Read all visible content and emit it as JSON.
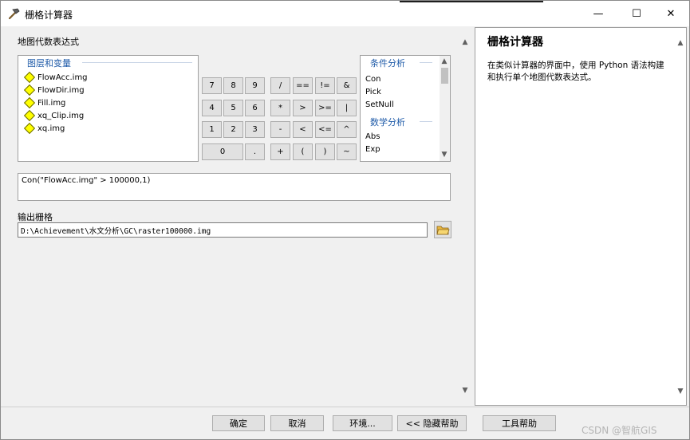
{
  "window": {
    "title": "栅格计算器",
    "minimize": "—",
    "maximize": "☐",
    "close": "✕"
  },
  "expression_section": {
    "label": "地图代数表达式"
  },
  "layers": {
    "group_title": "图层和变量",
    "items": [
      "FlowAcc.img",
      "FlowDir.img",
      "Fill.img",
      "xq_Clip.img",
      "xq.img"
    ]
  },
  "keypad": {
    "rows": [
      [
        "7",
        "8",
        "9",
        "/",
        "==",
        "!=",
        "&"
      ],
      [
        "4",
        "5",
        "6",
        "*",
        ">",
        ">=",
        "|"
      ],
      [
        "1",
        "2",
        "3",
        "-",
        "<",
        "<=",
        "^"
      ],
      [
        "0",
        ".",
        "+",
        "(",
        ")",
        "~"
      ]
    ]
  },
  "functions": {
    "group1_title": "条件分析",
    "group1_items": [
      "Con",
      "Pick",
      "SetNull"
    ],
    "group2_title": "数学分析",
    "group2_items": [
      "Abs",
      "Exp"
    ]
  },
  "expression": {
    "value": "Con(\"FlowAcc.img\" > 100000,1)"
  },
  "output": {
    "label": "输出栅格",
    "value": "D:\\Achievement\\水文分析\\GC\\raster100000.img"
  },
  "help": {
    "title": "栅格计算器",
    "text": "在类似计算器的界面中，使用 Python 语法构建和执行单个地图代数表达式。"
  },
  "buttons": {
    "ok": "确定",
    "cancel": "取消",
    "environments": "环境...",
    "hide_help": "<< 隐藏帮助",
    "tool_help": "工具帮助"
  },
  "watermark": "CSDN @智航GIS"
}
